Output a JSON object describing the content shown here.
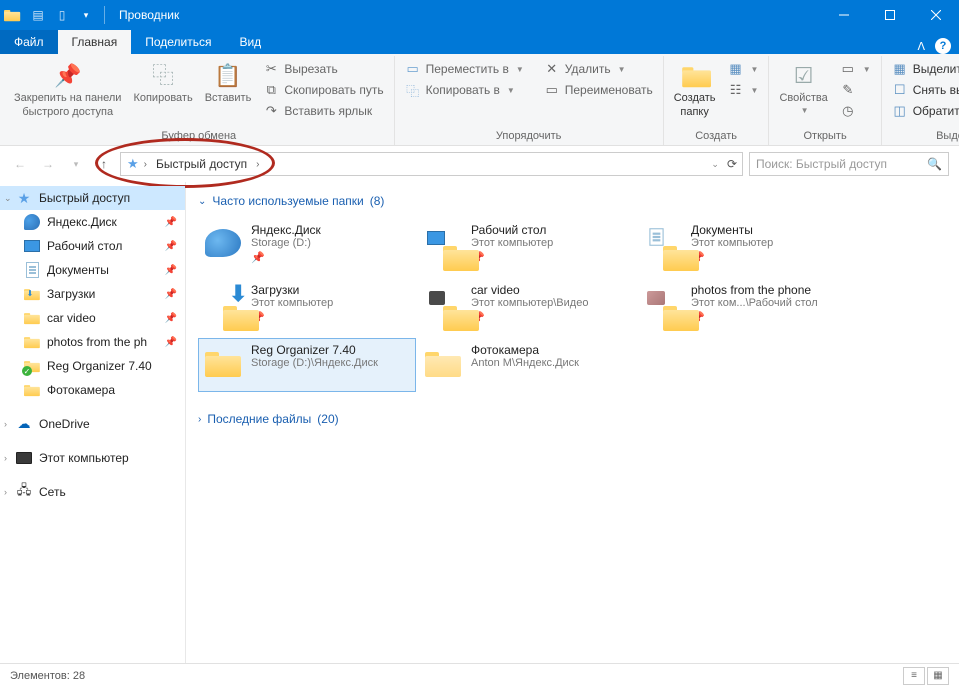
{
  "titlebar": {
    "title": "Проводник"
  },
  "tabs": {
    "file": "Файл",
    "home": "Главная",
    "share": "Поделиться",
    "view": "Вид"
  },
  "ribbon": {
    "clipboard": {
      "label": "Буфер обмена",
      "pin": "Закрепить на панели\nбыстрого доступа",
      "copy": "Копировать",
      "paste": "Вставить",
      "cut": "Вырезать",
      "copypath": "Скопировать путь",
      "pastelink": "Вставить ярлык"
    },
    "organize": {
      "label": "Упорядочить",
      "moveto": "Переместить в",
      "copyto": "Копировать в",
      "delete": "Удалить",
      "rename": "Переименовать"
    },
    "create": {
      "label": "Создать",
      "newfolder": "Создать\nпапку"
    },
    "open": {
      "label": "Открыть",
      "properties": "Свойства"
    },
    "select": {
      "label": "Выделить",
      "selectall": "Выделить все",
      "selectnone": "Снять выделение",
      "invert": "Обратить выделение"
    }
  },
  "breadcrumb": {
    "root": "Быстрый доступ"
  },
  "search": {
    "placeholder": "Поиск: Быстрый доступ"
  },
  "sidebar": {
    "items": [
      {
        "label": "Быстрый доступ",
        "icon": "qa",
        "root": true,
        "selected": true,
        "exp": true
      },
      {
        "label": "Яндекс.Диск",
        "icon": "yd",
        "pin": true
      },
      {
        "label": "Рабочий стол",
        "icon": "desk",
        "pin": true
      },
      {
        "label": "Документы",
        "icon": "doc",
        "pin": true
      },
      {
        "label": "Загрузки",
        "icon": "dl",
        "pin": true
      },
      {
        "label": "car video",
        "icon": "folder",
        "pin": true
      },
      {
        "label": "photos from the ph",
        "icon": "folder",
        "pin": true
      },
      {
        "label": "Reg Organizer 7.40",
        "icon": "folder",
        "sync": true
      },
      {
        "label": "Фотокамера",
        "icon": "folder"
      }
    ],
    "onedrive": "OneDrive",
    "thispc": "Этот компьютер",
    "network": "Сеть"
  },
  "content": {
    "section1": {
      "title": "Часто используемые папки",
      "count": "(8)"
    },
    "section2": {
      "title": "Последние файлы",
      "count": "(20)"
    },
    "folders": [
      {
        "name": "Яндекс.Диск",
        "sub": "Storage (D:)",
        "pin": true,
        "icon": "yd"
      },
      {
        "name": "Рабочий стол",
        "sub": "Этот компьютер",
        "pin": true,
        "icon": "desk"
      },
      {
        "name": "Документы",
        "sub": "Этот компьютер",
        "pin": true,
        "icon": "doc"
      },
      {
        "name": "Загрузки",
        "sub": "Этот компьютер",
        "pin": true,
        "icon": "dl"
      },
      {
        "name": "car video",
        "sub": "Этот компьютер\\Видео",
        "pin": true,
        "icon": "folder-vid"
      },
      {
        "name": "photos from the phone",
        "sub": "Этот ком...\\Рабочий стол",
        "pin": true,
        "icon": "folder-pic"
      },
      {
        "name": "Reg Organizer 7.40",
        "sub": "Storage (D:)\\Яндекс.Диск",
        "pin": false,
        "icon": "folder",
        "selected": true
      },
      {
        "name": "Фотокамера",
        "sub": "Anton M\\Яндекс.Диск",
        "pin": false,
        "icon": "folder-empty"
      }
    ]
  },
  "statusbar": {
    "count": "Элементов: 28"
  }
}
